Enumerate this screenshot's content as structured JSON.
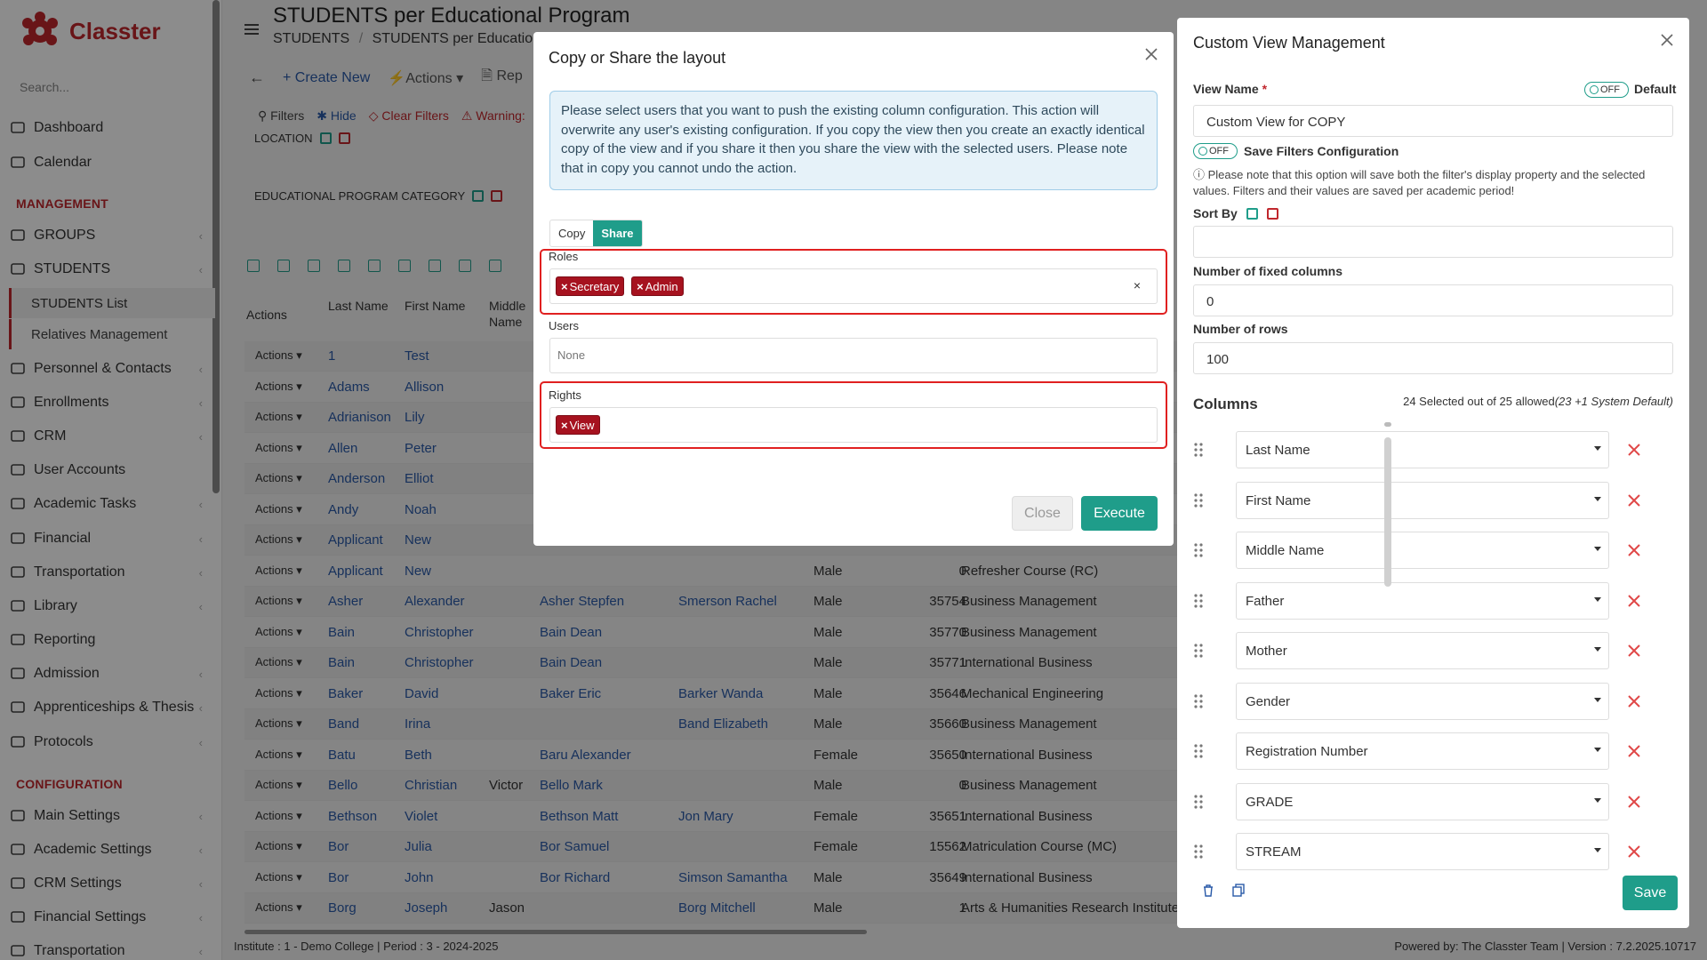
{
  "app": {
    "name": "Classter",
    "search_placeholder": "Search..."
  },
  "sidebar": {
    "items_top": [
      {
        "label": "Dashboard",
        "icon": "monitor-icon"
      },
      {
        "label": "Calendar",
        "icon": "calendar-icon"
      }
    ],
    "section_management": "MANAGEMENT",
    "items_management": [
      {
        "label": "GROUPS",
        "icon": "groups-icon"
      },
      {
        "label": "STUDENTS",
        "icon": "students-icon"
      }
    ],
    "sub_items": [
      {
        "label": "STUDENTS List"
      },
      {
        "label": "Relatives Management"
      }
    ],
    "items_mid": [
      {
        "label": "Personnel & Contacts",
        "icon": "personnel-icon"
      },
      {
        "label": "Enrollments",
        "icon": "enrollments-icon"
      },
      {
        "label": "CRM",
        "icon": "crm-icon"
      },
      {
        "label": "User Accounts",
        "icon": "key-icon"
      },
      {
        "label": "Academic Tasks",
        "icon": "tasks-icon"
      },
      {
        "label": "Financial",
        "icon": "financial-icon"
      },
      {
        "label": "Transportation",
        "icon": "bus-icon"
      },
      {
        "label": "Library",
        "icon": "library-icon"
      },
      {
        "label": "Reporting",
        "icon": "printer-icon"
      },
      {
        "label": "Admission",
        "icon": "admission-icon"
      },
      {
        "label": "Apprenticeships & Thesis",
        "icon": "apprenticeship-icon"
      },
      {
        "label": "Protocols",
        "icon": "protocols-icon"
      }
    ],
    "section_configuration": "CONFIGURATION",
    "items_config": [
      {
        "label": "Main Settings",
        "icon": "settings-icon"
      },
      {
        "label": "Academic Settings",
        "icon": "academic-settings-icon"
      },
      {
        "label": "CRM Settings",
        "icon": "crm-settings-icon"
      },
      {
        "label": "Financial Settings",
        "icon": "financial-settings-icon"
      },
      {
        "label": "Transportation",
        "icon": "bus-icon"
      }
    ]
  },
  "page": {
    "title": "STUDENTS per Educational Program",
    "breadcrumb_1": "STUDENTS",
    "breadcrumb_sep": "/",
    "breadcrumb_2": "STUDENTS per Educational P",
    "create_new": "Create New",
    "actions": "Actions",
    "rep": "Rep",
    "filters": "Filters",
    "hide": "Hide",
    "clear_filters": "Clear Filters",
    "warning": "Warning:",
    "location": "LOCATION",
    "edu_category": "EDUCATIONAL PROGRAM CATEGORY"
  },
  "table": {
    "headers": {
      "actions": "Actions",
      "last_name": "Last Name",
      "first_name": "First Name",
      "middle_name": "Middle Name"
    },
    "action_label": "Actions",
    "rows": [
      {
        "ln": "1",
        "fn": "Test",
        "mn": "",
        "f": "",
        "m": "",
        "g": "",
        "r": "",
        "p": ""
      },
      {
        "ln": "Adams",
        "fn": "Allison",
        "mn": "",
        "f": "",
        "m": "",
        "g": "",
        "r": "",
        "p": ""
      },
      {
        "ln": "Adrianison",
        "fn": "Lily",
        "mn": "",
        "f": "",
        "m": "",
        "g": "",
        "r": "",
        "p": ""
      },
      {
        "ln": "Allen",
        "fn": "Peter",
        "mn": "",
        "f": "",
        "m": "",
        "g": "",
        "r": "",
        "p": ""
      },
      {
        "ln": "Anderson",
        "fn": "Elliot",
        "mn": "",
        "f": "",
        "m": "",
        "g": "",
        "r": "",
        "p": ""
      },
      {
        "ln": "Andy",
        "fn": "Noah",
        "mn": "",
        "f": "",
        "m": "",
        "g": "",
        "r": "",
        "p": ""
      },
      {
        "ln": "Applicant",
        "fn": "New",
        "mn": "",
        "f": "",
        "m": "",
        "g": "",
        "r": "",
        "p": ""
      },
      {
        "ln": "Applicant",
        "fn": "New",
        "mn": "",
        "f": "",
        "m": "",
        "g": "Male",
        "r": "0",
        "p": "Refresher Course (RC)"
      },
      {
        "ln": "Asher",
        "fn": "Alexander",
        "mn": "",
        "f": "Asher Stepfen",
        "m": "Smerson Rachel",
        "g": "Male",
        "r": "35754",
        "p": "Business Management"
      },
      {
        "ln": "Bain",
        "fn": "Christopher",
        "mn": "",
        "f": "Bain Dean",
        "m": "",
        "g": "Male",
        "r": "35770",
        "p": "Business Management"
      },
      {
        "ln": "Bain",
        "fn": "Christopher",
        "mn": "",
        "f": "Bain Dean",
        "m": "",
        "g": "Male",
        "r": "35771",
        "p": "International Business"
      },
      {
        "ln": "Baker",
        "fn": "David",
        "mn": "",
        "f": "Baker Eric",
        "m": "Barker Wanda",
        "g": "Male",
        "r": "35646",
        "p": "Mechanical Engineering"
      },
      {
        "ln": "Band",
        "fn": "Irina",
        "mn": "",
        "f": "",
        "m": "Band Elizabeth",
        "g": "Male",
        "r": "35660",
        "p": "Business Management"
      },
      {
        "ln": "Batu",
        "fn": "Beth",
        "mn": "",
        "f": "Baru Alexander",
        "m": "",
        "g": "Female",
        "r": "35650",
        "p": "International Business"
      },
      {
        "ln": "Bello",
        "fn": "Christian",
        "mn": "Victor",
        "f": "Bello Mark",
        "m": "",
        "g": "Male",
        "r": "0",
        "p": "Business Management"
      },
      {
        "ln": "Bethson",
        "fn": "Violet",
        "mn": "",
        "f": "Bethson Matt",
        "m": "Jon Mary",
        "g": "Female",
        "r": "35651",
        "p": "International Business"
      },
      {
        "ln": "Bor",
        "fn": "Julia",
        "mn": "",
        "f": "Bor Samuel",
        "m": "",
        "g": "Female",
        "r": "15562",
        "p": "Matriculation Course (MC)"
      },
      {
        "ln": "Bor",
        "fn": "John",
        "mn": "",
        "f": "Bor Richard",
        "m": "Simson Samantha",
        "g": "Male",
        "r": "35649",
        "p": "International Business"
      },
      {
        "ln": "Borg",
        "fn": "Joseph",
        "mn": "Jason",
        "f": "",
        "m": "Borg Mitchell",
        "g": "Male",
        "r": "1",
        "p": "Arts & Humanities Research Institute"
      }
    ]
  },
  "footer": {
    "left": "Institute : 1 - Demo College | Period : 3 - 2024-2025",
    "powered": "Powered by: The Classter Team",
    "version": "| Version : 7.2.2025.10717"
  },
  "modal": {
    "title": "Copy or Share the layout",
    "notice": "Please select users that you want to push the existing column configuration. This action will overwrite any user's existing configuration. If you copy the view then you create an exactly identical copy of the view and if you share it then you share the view with the selected users. Please note that in copy you cannot undo the action.",
    "tab_copy": "Copy",
    "tab_share": "Share",
    "roles_label": "Roles",
    "roles": [
      "Secretary",
      "Admin"
    ],
    "users_label": "Users",
    "users_placeholder": "None",
    "rights_label": "Rights",
    "rights": [
      "View"
    ],
    "close": "Close",
    "execute": "Execute"
  },
  "panel": {
    "title": "Custom View Management",
    "view_name_label": "View Name",
    "required_mark": "*",
    "toggle_off": "OFF",
    "default_label": "Default",
    "view_name_value": "Custom View for COPY",
    "save_filters_label": "Save Filters Configuration",
    "note": "Please note that this option will save both the filter's display property and the selected values. Filters and their values are saved per academic period!",
    "sort_by": "Sort By",
    "fixed_columns_label": "Number of fixed columns",
    "fixed_columns_value": "0",
    "rows_label": "Number of rows",
    "rows_value": "100",
    "columns_label": "Columns",
    "columns_count": "24 Selected out of 25 allowed",
    "columns_count_note": "(23 +1 System Default)",
    "columns": [
      "Last Name",
      "First Name",
      "Middle Name",
      "Father",
      "Mother",
      "Gender",
      "Registration Number",
      "GRADE",
      "STREAM"
    ],
    "save": "Save"
  },
  "colors": {
    "brand": "#c0272d",
    "accent": "#1f9d8a",
    "tag": "#a6121f",
    "highlight": "#e02020"
  }
}
